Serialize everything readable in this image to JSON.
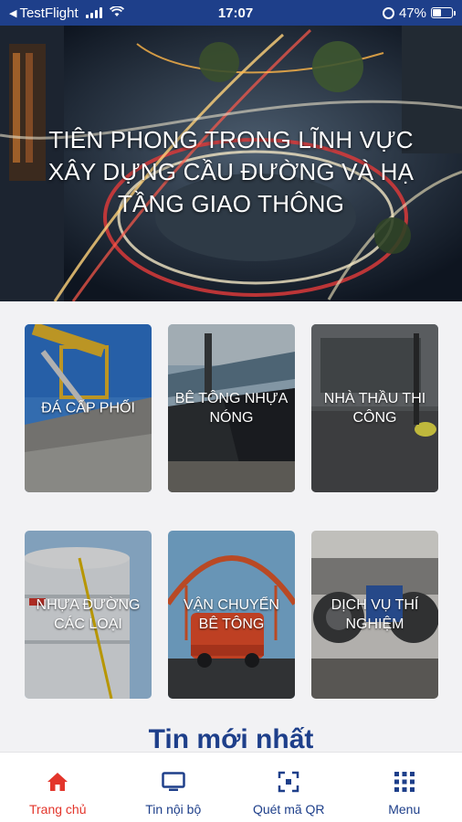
{
  "status_bar": {
    "back_app": "TestFlight",
    "time": "17:07",
    "battery_percent": "47%",
    "battery_level": 0.47
  },
  "hero": {
    "title": "TIÊN PHONG TRONG LĨNH VỰC XÂY DỰNG CẦU ĐƯỜNG VÀ HẠ TẦNG GIAO THÔNG"
  },
  "services": [
    {
      "label": "ĐÁ CẤP PHỐI"
    },
    {
      "label": "BÊ TÔNG NHỰA NÓNG"
    },
    {
      "label": "NHÀ THẦU THI CÔNG"
    },
    {
      "label": "NHỰA ĐƯỜNG CÁC LOẠI"
    },
    {
      "label": "VẬN CHUYỂN BÊ TÔNG"
    },
    {
      "label": "DỊCH VỤ THÍ NGHIỆM"
    }
  ],
  "news": {
    "heading": "Tin mới nhất"
  },
  "tab_bar": {
    "active_color": "#e3352b",
    "inactive_color": "#1e3f8a",
    "items": [
      {
        "label": "Trang chủ",
        "icon": "home-icon"
      },
      {
        "label": "Tin nội bộ",
        "icon": "monitor-icon"
      },
      {
        "label": "Quét mã QR",
        "icon": "qr-scan-icon"
      },
      {
        "label": "Menu",
        "icon": "grid-menu-icon"
      }
    ]
  }
}
